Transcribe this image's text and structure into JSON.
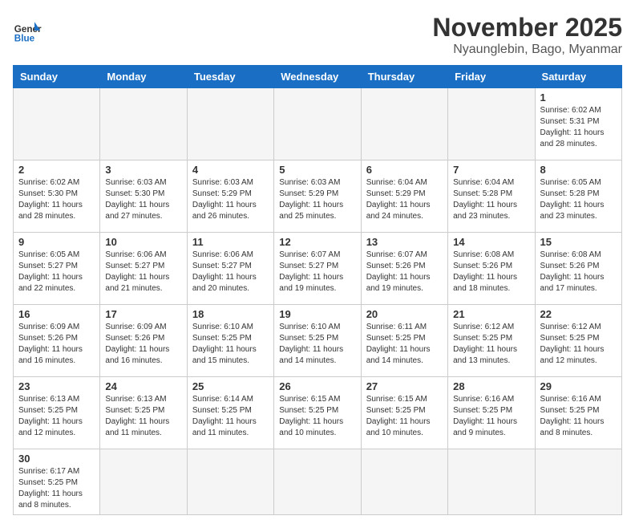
{
  "header": {
    "logo_general": "General",
    "logo_blue": "Blue",
    "month": "November 2025",
    "location": "Nyaunglebin, Bago, Myanmar"
  },
  "days_of_week": [
    "Sunday",
    "Monday",
    "Tuesday",
    "Wednesday",
    "Thursday",
    "Friday",
    "Saturday"
  ],
  "weeks": [
    [
      {
        "day": "",
        "info": ""
      },
      {
        "day": "",
        "info": ""
      },
      {
        "day": "",
        "info": ""
      },
      {
        "day": "",
        "info": ""
      },
      {
        "day": "",
        "info": ""
      },
      {
        "day": "",
        "info": ""
      },
      {
        "day": "1",
        "info": "Sunrise: 6:02 AM\nSunset: 5:31 PM\nDaylight: 11 hours\nand 28 minutes."
      }
    ],
    [
      {
        "day": "2",
        "info": "Sunrise: 6:02 AM\nSunset: 5:30 PM\nDaylight: 11 hours\nand 28 minutes."
      },
      {
        "day": "3",
        "info": "Sunrise: 6:03 AM\nSunset: 5:30 PM\nDaylight: 11 hours\nand 27 minutes."
      },
      {
        "day": "4",
        "info": "Sunrise: 6:03 AM\nSunset: 5:29 PM\nDaylight: 11 hours\nand 26 minutes."
      },
      {
        "day": "5",
        "info": "Sunrise: 6:03 AM\nSunset: 5:29 PM\nDaylight: 11 hours\nand 25 minutes."
      },
      {
        "day": "6",
        "info": "Sunrise: 6:04 AM\nSunset: 5:29 PM\nDaylight: 11 hours\nand 24 minutes."
      },
      {
        "day": "7",
        "info": "Sunrise: 6:04 AM\nSunset: 5:28 PM\nDaylight: 11 hours\nand 23 minutes."
      },
      {
        "day": "8",
        "info": "Sunrise: 6:05 AM\nSunset: 5:28 PM\nDaylight: 11 hours\nand 23 minutes."
      }
    ],
    [
      {
        "day": "9",
        "info": "Sunrise: 6:05 AM\nSunset: 5:27 PM\nDaylight: 11 hours\nand 22 minutes."
      },
      {
        "day": "10",
        "info": "Sunrise: 6:06 AM\nSunset: 5:27 PM\nDaylight: 11 hours\nand 21 minutes."
      },
      {
        "day": "11",
        "info": "Sunrise: 6:06 AM\nSunset: 5:27 PM\nDaylight: 11 hours\nand 20 minutes."
      },
      {
        "day": "12",
        "info": "Sunrise: 6:07 AM\nSunset: 5:27 PM\nDaylight: 11 hours\nand 19 minutes."
      },
      {
        "day": "13",
        "info": "Sunrise: 6:07 AM\nSunset: 5:26 PM\nDaylight: 11 hours\nand 19 minutes."
      },
      {
        "day": "14",
        "info": "Sunrise: 6:08 AM\nSunset: 5:26 PM\nDaylight: 11 hours\nand 18 minutes."
      },
      {
        "day": "15",
        "info": "Sunrise: 6:08 AM\nSunset: 5:26 PM\nDaylight: 11 hours\nand 17 minutes."
      }
    ],
    [
      {
        "day": "16",
        "info": "Sunrise: 6:09 AM\nSunset: 5:26 PM\nDaylight: 11 hours\nand 16 minutes."
      },
      {
        "day": "17",
        "info": "Sunrise: 6:09 AM\nSunset: 5:26 PM\nDaylight: 11 hours\nand 16 minutes."
      },
      {
        "day": "18",
        "info": "Sunrise: 6:10 AM\nSunset: 5:25 PM\nDaylight: 11 hours\nand 15 minutes."
      },
      {
        "day": "19",
        "info": "Sunrise: 6:10 AM\nSunset: 5:25 PM\nDaylight: 11 hours\nand 14 minutes."
      },
      {
        "day": "20",
        "info": "Sunrise: 6:11 AM\nSunset: 5:25 PM\nDaylight: 11 hours\nand 14 minutes."
      },
      {
        "day": "21",
        "info": "Sunrise: 6:12 AM\nSunset: 5:25 PM\nDaylight: 11 hours\nand 13 minutes."
      },
      {
        "day": "22",
        "info": "Sunrise: 6:12 AM\nSunset: 5:25 PM\nDaylight: 11 hours\nand 12 minutes."
      }
    ],
    [
      {
        "day": "23",
        "info": "Sunrise: 6:13 AM\nSunset: 5:25 PM\nDaylight: 11 hours\nand 12 minutes."
      },
      {
        "day": "24",
        "info": "Sunrise: 6:13 AM\nSunset: 5:25 PM\nDaylight: 11 hours\nand 11 minutes."
      },
      {
        "day": "25",
        "info": "Sunrise: 6:14 AM\nSunset: 5:25 PM\nDaylight: 11 hours\nand 11 minutes."
      },
      {
        "day": "26",
        "info": "Sunrise: 6:15 AM\nSunset: 5:25 PM\nDaylight: 11 hours\nand 10 minutes."
      },
      {
        "day": "27",
        "info": "Sunrise: 6:15 AM\nSunset: 5:25 PM\nDaylight: 11 hours\nand 10 minutes."
      },
      {
        "day": "28",
        "info": "Sunrise: 6:16 AM\nSunset: 5:25 PM\nDaylight: 11 hours\nand 9 minutes."
      },
      {
        "day": "29",
        "info": "Sunrise: 6:16 AM\nSunset: 5:25 PM\nDaylight: 11 hours\nand 8 minutes."
      }
    ],
    [
      {
        "day": "30",
        "info": "Sunrise: 6:17 AM\nSunset: 5:25 PM\nDaylight: 11 hours\nand 8 minutes."
      },
      {
        "day": "",
        "info": ""
      },
      {
        "day": "",
        "info": ""
      },
      {
        "day": "",
        "info": ""
      },
      {
        "day": "",
        "info": ""
      },
      {
        "day": "",
        "info": ""
      },
      {
        "day": "",
        "info": ""
      }
    ]
  ]
}
